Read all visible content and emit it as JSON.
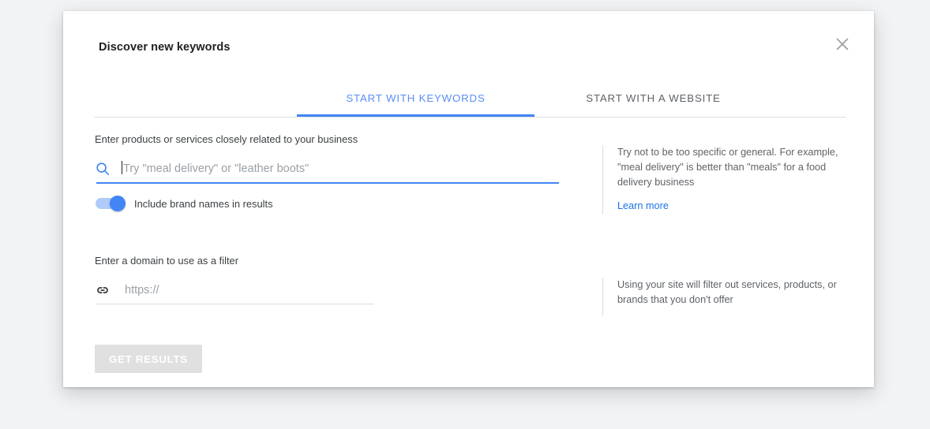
{
  "dialog": {
    "title": "Discover new keywords",
    "close_icon": "close-icon"
  },
  "tabs": [
    {
      "label": "START WITH KEYWORDS",
      "active": true
    },
    {
      "label": "START WITH A WEBSITE",
      "active": false
    }
  ],
  "keywords_section": {
    "label": "Enter products or services closely related to your business",
    "input": {
      "icon": "search-icon",
      "value": "",
      "placeholder": "Try \"meal delivery\" or \"leather boots\""
    },
    "toggle": {
      "label": "Include brand names in results",
      "state": "on"
    },
    "help": {
      "text": "Try not to be too specific or general. For example, \"meal delivery\" is better than \"meals\" for a food delivery business",
      "link_label": "Learn more"
    }
  },
  "domain_section": {
    "label": "Enter a domain to use as a filter",
    "input": {
      "icon": "link-icon",
      "value": "",
      "placeholder": "https://"
    },
    "help": {
      "text": "Using your site will filter out services, products, or brands that you don't offer"
    }
  },
  "footer": {
    "submit_label": "GET RESULTS",
    "submit_enabled": false
  },
  "colors": {
    "accent": "#4285f4",
    "link": "#1a73e8",
    "toggle_track": "#aecbfa",
    "page_bg": "#f1f3f4",
    "disabled_button": "#e0e0e0"
  }
}
